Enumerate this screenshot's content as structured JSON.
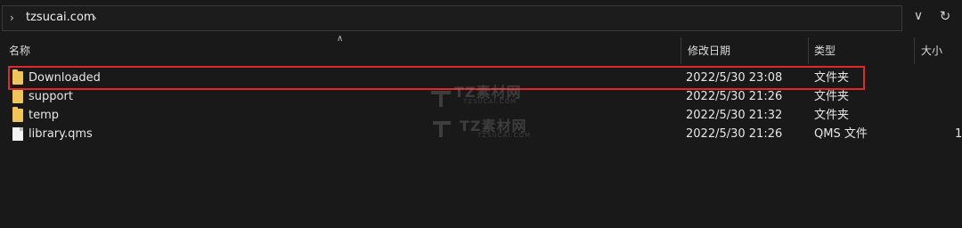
{
  "address": {
    "path": "tzsucai.com"
  },
  "columns": {
    "name": "名称",
    "modified": "修改日期",
    "type": "类型",
    "size": "大小"
  },
  "files": [
    {
      "name": "Downloaded",
      "date": "2022/5/30 23:08",
      "type": "文件夹",
      "size": "",
      "icon": "folder-icon"
    },
    {
      "name": "support",
      "date": "2022/5/30 21:26",
      "type": "文件夹",
      "size": "",
      "icon": "folder-icon"
    },
    {
      "name": "temp",
      "date": "2022/5/30 21:32",
      "type": "文件夹",
      "size": "",
      "icon": "folder-icon"
    },
    {
      "name": "library.qms",
      "date": "2022/5/30 21:26",
      "type": "QMS 文件",
      "size": "1",
      "icon": "file-icon"
    }
  ],
  "watermark": {
    "title": "TZ素材网",
    "subtitle": "TZSUCAI.COM"
  },
  "colors": {
    "background": "#191919",
    "highlight": "#e0272b",
    "folder": "#f0c45a"
  }
}
